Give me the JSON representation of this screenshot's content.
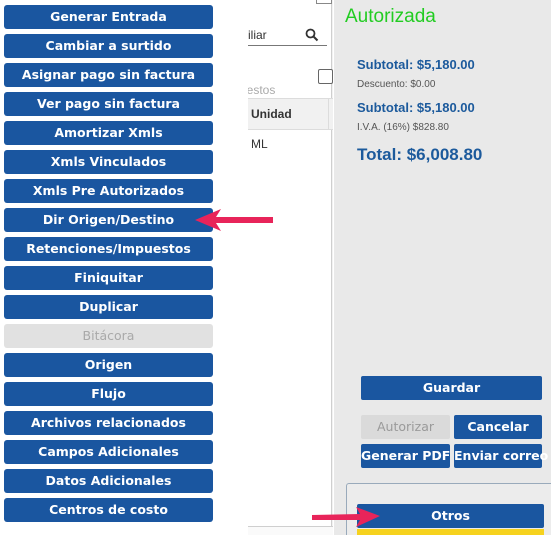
{
  "menu": {
    "items": [
      {
        "label": "Generar Entrada",
        "enabled": true
      },
      {
        "label": "Cambiar a surtido",
        "enabled": true
      },
      {
        "label": "Asignar pago sin factura",
        "enabled": true
      },
      {
        "label": "Ver pago sin factura",
        "enabled": true
      },
      {
        "label": "Amortizar Xmls",
        "enabled": true
      },
      {
        "label": "Xmls Vinculados",
        "enabled": true
      },
      {
        "label": "Xmls Pre Autorizados",
        "enabled": true
      },
      {
        "label": "Dir Origen/Destino",
        "enabled": true
      },
      {
        "label": "Retenciones/Impuestos",
        "enabled": true
      },
      {
        "label": "Finiquitar",
        "enabled": true
      },
      {
        "label": "Duplicar",
        "enabled": true
      },
      {
        "label": "Bitácora",
        "enabled": false
      },
      {
        "label": "Origen",
        "enabled": true
      },
      {
        "label": "Flujo",
        "enabled": true
      },
      {
        "label": "Archivos relacionados",
        "enabled": true
      },
      {
        "label": "Campos Adicionales",
        "enabled": true
      },
      {
        "label": "Datos Adicionales",
        "enabled": true
      },
      {
        "label": "Centros de costo",
        "enabled": true
      }
    ]
  },
  "table": {
    "search_text": "xiliar",
    "impuestos_text": "uestos",
    "column_unidad": "Unidad",
    "row_unit_value": "ML"
  },
  "summary": {
    "status": "Autorizada",
    "subtotal1": "Subtotal: $5,180.00",
    "descuento": "Descuento: $0.00",
    "subtotal2": "Subtotal: $5,180.00",
    "iva": "I.V.A. (16%) $828.80",
    "total": "Total: $6,008.80"
  },
  "actions": {
    "guardar": "Guardar",
    "autorizar": "Autorizar",
    "cancelar": "Cancelar",
    "generar_pdf": "Generar PDF",
    "enviar_correo": "Enviar correo",
    "otros": "Otros"
  },
  "colors": {
    "primary_button": "#1a56a0",
    "status_green": "#22cc22",
    "arrow": "#e8245a",
    "summary_blue": "#1c5a9c"
  }
}
